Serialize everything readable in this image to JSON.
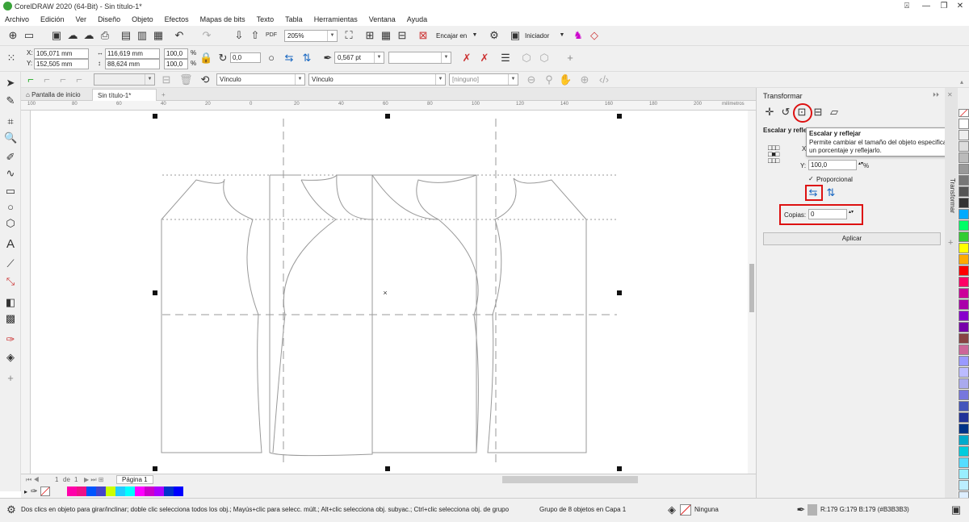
{
  "window": {
    "title": "CorelDRAW 2020 (64-Bit) - Sin título-1*"
  },
  "menu": [
    {
      "label": "Archivo"
    },
    {
      "label": "Edición"
    },
    {
      "label": "Ver"
    },
    {
      "label": "Diseño"
    },
    {
      "label": "Objeto"
    },
    {
      "label": "Efectos"
    },
    {
      "label": "Mapas de bits"
    },
    {
      "label": "Texto"
    },
    {
      "label": "Tabla"
    },
    {
      "label": "Herramientas"
    },
    {
      "label": "Ventana"
    },
    {
      "label": "Ayuda"
    }
  ],
  "toolbar": {
    "zoom": "205%",
    "snap_label": "Encajar en",
    "launch_label": "Iniciador"
  },
  "props": {
    "x": "105,071 mm",
    "y": "152,505 mm",
    "w": "116,619 mm",
    "h": "88,624 mm",
    "scale_w": "100,0",
    "scale_h": "100,0",
    "pct": "%",
    "rotation": "0,0",
    "outline": "0,567 pt"
  },
  "props3": {
    "link1": "Vínculo",
    "link2": "Vínculo",
    "none": "[ninguno]"
  },
  "tabs": {
    "home": "Pantalla de inicio",
    "doc": "Sin título-1*"
  },
  "ruler": {
    "ticks": [
      "100",
      "80",
      "60",
      "40",
      "20",
      "0",
      "20",
      "40",
      "60",
      "80",
      "100",
      "120",
      "140",
      "160",
      "180",
      "200"
    ],
    "unit": "milímetros"
  },
  "pages": {
    "current": "1",
    "sep": "de",
    "total": "1",
    "page_tab": "Página 1"
  },
  "docker": {
    "title": "Transformar",
    "section": "Escalar y refle",
    "y_label": "Y:",
    "y_value": "100,0",
    "pct": "%",
    "x_label": "X",
    "proportional": "Proporcional",
    "copies_label": "Copias:",
    "copies_value": "0",
    "apply": "Aplicar",
    "tab_label": "Transformar"
  },
  "tooltip": {
    "title": "Escalar y reflejar",
    "body": "Permite cambiar el tamaño del objeto especificando un porcentaje y reflejarlo."
  },
  "status": {
    "hint": "Dos clics en objeto para girar/inclinar; doble clic selecciona todos los obj.; Mayús+clic para selecc. múlt.; Alt+clic selecciona obj. subyac.; Ctrl+clic selecciona obj. de grupo",
    "group": "Grupo de 8 objetos en Capa 1",
    "fill": "Ninguna",
    "color": "R:179 G:179 B:179 (#B3B3B3)"
  },
  "colors": {
    "palette_h": [
      "#ff00aa",
      "#ee1188",
      "#0055ff",
      "#4444cc",
      "#ccff00",
      "#22ccff",
      "#00ffff",
      "#ff00ff",
      "#cc00cc",
      "#aa00ff",
      "#0033cc",
      "#0000ff"
    ],
    "palette_v": [
      "#ffffff",
      "#eeeeee",
      "#dddddd",
      "#bbbbbb",
      "#999999",
      "#777777",
      "#555555",
      "#333333",
      "#00aaff",
      "#00ff66",
      "#33cc33",
      "#ffff00",
      "#ffaa00",
      "#ff0000",
      "#ff0066",
      "#cc0099",
      "#aa00aa",
      "#8800cc",
      "#7700aa",
      "#884444",
      "#cc6699",
      "#9999ff",
      "#bbbbff",
      "#aaaaee",
      "#7777dd",
      "#4455bb",
      "#223399",
      "#003388",
      "#00aacc",
      "#00ccdd",
      "#55ddff",
      "#99eeff",
      "#bbeeff",
      "#ddeeff"
    ]
  }
}
